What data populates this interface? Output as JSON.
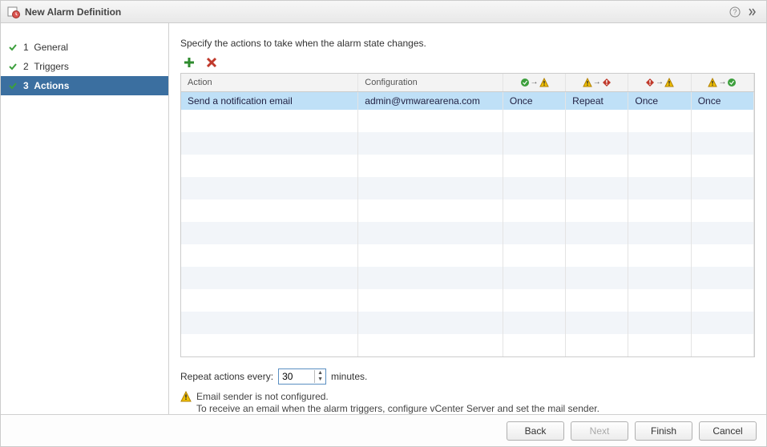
{
  "title": "New Alarm Definition",
  "sidebar": {
    "steps": [
      {
        "num": "1",
        "label": "General",
        "done": true,
        "active": false
      },
      {
        "num": "2",
        "label": "Triggers",
        "done": true,
        "active": false
      },
      {
        "num": "3",
        "label": "Actions",
        "done": true,
        "active": true
      }
    ]
  },
  "main": {
    "instruction": "Specify the actions to take when the alarm state changes.",
    "columns": {
      "action": "Action",
      "config": "Configuration"
    },
    "row": {
      "action": "Send a notification email",
      "config": "admin@vmwarearena.com",
      "s1": "Once",
      "s2": "Repeat",
      "s3": "Once",
      "s4": "Once"
    },
    "repeat": {
      "label_before": "Repeat actions every:",
      "value": "30",
      "label_after": "minutes."
    },
    "warning": {
      "line1": "Email sender is not configured.",
      "line2": "To receive an email when the alarm triggers, configure vCenter Server and set the mail sender."
    }
  },
  "footer": {
    "back": "Back",
    "next": "Next",
    "finish": "Finish",
    "cancel": "Cancel"
  }
}
